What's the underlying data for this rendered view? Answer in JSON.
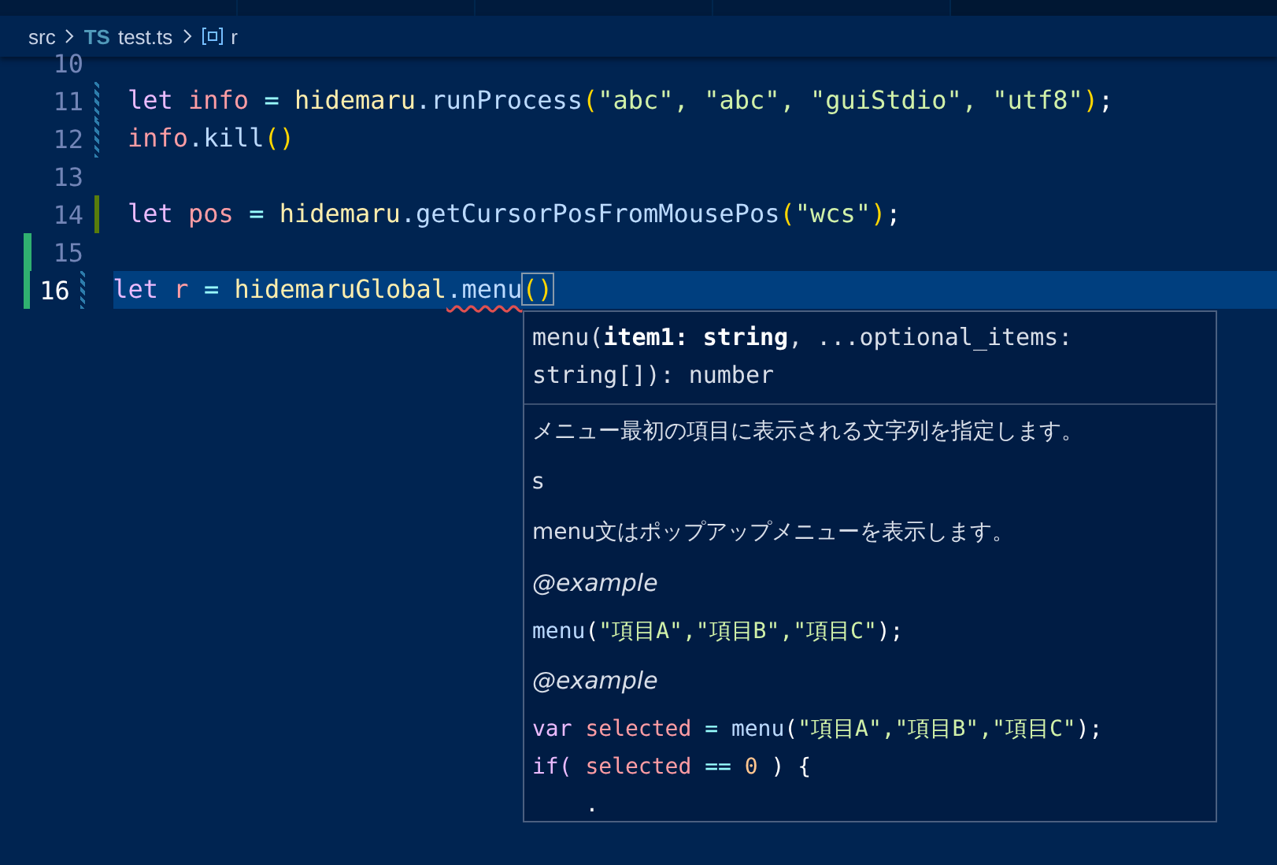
{
  "breadcrumb": [
    {
      "kind": "folder",
      "label": "src"
    },
    {
      "kind": "ts",
      "label": "test.ts",
      "badge": "TS"
    },
    {
      "kind": "symbol",
      "label": "r"
    }
  ],
  "code_lines": [
    {
      "number": "10",
      "modified": false,
      "added": false,
      "left_added": false,
      "current": false
    },
    {
      "number": "11",
      "modified": true,
      "added": false,
      "left_added": false,
      "current": false,
      "tokens": [
        {
          "kind": "keyword",
          "text": "let "
        },
        {
          "kind": "variable",
          "text": "info "
        },
        {
          "kind": "operator",
          "text": "= "
        },
        {
          "kind": "object",
          "text": "hidemaru"
        },
        {
          "kind": "function",
          "text": ".runProcess"
        },
        {
          "kind": "paren",
          "text": "("
        },
        {
          "kind": "string",
          "text": "\"abc\", \"abc\", \"guiStdio\", \"utf8\""
        },
        {
          "kind": "paren",
          "text": ")"
        },
        {
          "kind": "plain",
          "text": ";"
        }
      ]
    },
    {
      "number": "12",
      "modified": true,
      "added": false,
      "left_added": false,
      "current": false,
      "tokens": [
        {
          "kind": "variable",
          "text": "info"
        },
        {
          "kind": "function",
          "text": ".kill"
        },
        {
          "kind": "paren",
          "text": "()"
        }
      ]
    },
    {
      "number": "13",
      "modified": false,
      "added": false,
      "left_added": false,
      "current": false
    },
    {
      "number": "14",
      "modified": false,
      "added": true,
      "left_added": false,
      "current": false,
      "tokens": [
        {
          "kind": "keyword",
          "text": "let "
        },
        {
          "kind": "variable",
          "text": "pos "
        },
        {
          "kind": "operator",
          "text": "= "
        },
        {
          "kind": "object",
          "text": "hidemaru"
        },
        {
          "kind": "function",
          "text": ".getCursorPosFromMousePos"
        },
        {
          "kind": "paren",
          "text": "("
        },
        {
          "kind": "string",
          "text": "\"wcs\""
        },
        {
          "kind": "paren",
          "text": ")"
        },
        {
          "kind": "plain",
          "text": ";"
        }
      ]
    },
    {
      "number": "15",
      "modified": false,
      "added": false,
      "left_added": true,
      "current": false
    },
    {
      "number": "16",
      "modified": true,
      "added": false,
      "left_added": true,
      "current": true,
      "tokens": [
        {
          "kind": "keyword",
          "text": "let "
        },
        {
          "kind": "variable",
          "text": "r "
        },
        {
          "kind": "operator",
          "text": "= "
        },
        {
          "kind": "object",
          "text": "hidemaruGlobal"
        },
        {
          "kind": "error",
          "text": ".menu"
        },
        {
          "kind": "bracket-match",
          "text": "()"
        }
      ]
    }
  ],
  "hover": {
    "signature": "menu(**item1: string**, ...optional_items: string[]): number",
    "docs": [
      {
        "kind": "text",
        "text": "メニュー最初の項目に表示される文字列を指定します。"
      },
      {
        "kind": "text",
        "text": "s"
      },
      {
        "kind": "text",
        "text": "menu文はポップアップメニューを表示します。"
      },
      {
        "kind": "tag",
        "text": "@example"
      },
      {
        "kind": "code",
        "lines": [
          [
            {
              "kind": "function",
              "text": "menu"
            },
            {
              "kind": "plain",
              "text": "("
            },
            {
              "kind": "string",
              "text": "\"項目A\",\"項目B\",\"項目C\""
            },
            {
              "kind": "plain",
              "text": ");"
            }
          ]
        ]
      },
      {
        "kind": "tag",
        "text": "@example"
      },
      {
        "kind": "code",
        "lines": [
          [
            {
              "kind": "keyword",
              "text": "var "
            },
            {
              "kind": "variable",
              "text": "selected "
            },
            {
              "kind": "operator",
              "text": "= "
            },
            {
              "kind": "function",
              "text": "menu"
            },
            {
              "kind": "plain",
              "text": "("
            },
            {
              "kind": "string",
              "text": "\"項目A\",\"項目B\",\"項目C\""
            },
            {
              "kind": "plain",
              "text": ");"
            }
          ],
          [
            {
              "kind": "keyword",
              "text": "if( "
            },
            {
              "kind": "variable",
              "text": "selected "
            },
            {
              "kind": "operator",
              "text": "== "
            },
            {
              "kind": "number",
              "text": "0"
            },
            {
              "kind": "plain",
              "text": " ) {"
            }
          ],
          [
            {
              "kind": "plain",
              "text": "    ."
            }
          ]
        ]
      }
    ]
  }
}
